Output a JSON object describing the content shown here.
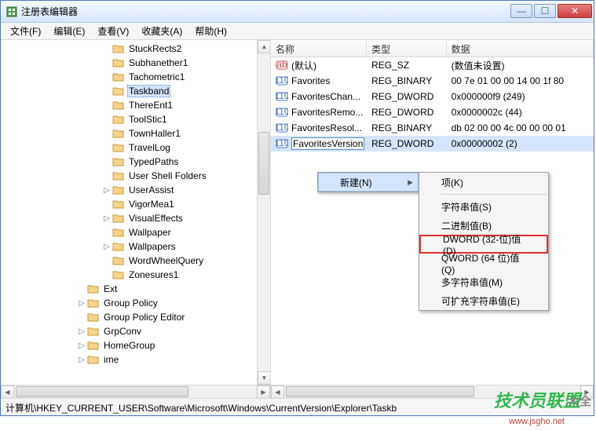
{
  "window": {
    "title": "注册表编辑器"
  },
  "menu": {
    "file": "文件(F)",
    "edit": "编辑(E)",
    "view": "查看(V)",
    "fav": "收藏夹(A)",
    "help": "帮助(H)"
  },
  "tree": {
    "items": [
      {
        "indent": 8,
        "expander": "",
        "label": "StuckRects2"
      },
      {
        "indent": 8,
        "expander": "",
        "label": "Subhanether1"
      },
      {
        "indent": 8,
        "expander": "",
        "label": "Tachometric1"
      },
      {
        "indent": 8,
        "expander": "",
        "label": "Taskband",
        "selected": true
      },
      {
        "indent": 8,
        "expander": "",
        "label": "ThereEnt1"
      },
      {
        "indent": 8,
        "expander": "",
        "label": "ToolStic1"
      },
      {
        "indent": 8,
        "expander": "",
        "label": "TownHaller1"
      },
      {
        "indent": 8,
        "expander": "",
        "label": "TravelLog"
      },
      {
        "indent": 8,
        "expander": "",
        "label": "TypedPaths"
      },
      {
        "indent": 8,
        "expander": "",
        "label": "User Shell Folders"
      },
      {
        "indent": 8,
        "expander": "▷",
        "label": "UserAssist"
      },
      {
        "indent": 8,
        "expander": "",
        "label": "VigorMea1"
      },
      {
        "indent": 8,
        "expander": "▷",
        "label": "VisualEffects"
      },
      {
        "indent": 8,
        "expander": "",
        "label": "Wallpaper"
      },
      {
        "indent": 8,
        "expander": "▷",
        "label": "Wallpapers"
      },
      {
        "indent": 8,
        "expander": "",
        "label": "WordWheelQuery"
      },
      {
        "indent": 8,
        "expander": "",
        "label": "Zonesures1"
      },
      {
        "indent": 6,
        "expander": "",
        "label": "Ext"
      },
      {
        "indent": 6,
        "expander": "▷",
        "label": "Group Policy"
      },
      {
        "indent": 6,
        "expander": "",
        "label": "Group Policy Editor"
      },
      {
        "indent": 6,
        "expander": "▷",
        "label": "GrpConv"
      },
      {
        "indent": 6,
        "expander": "▷",
        "label": "HomeGroup"
      },
      {
        "indent": 6,
        "expander": "▷",
        "label": "ime"
      }
    ]
  },
  "list": {
    "headers": {
      "name": "名称",
      "type": "类型",
      "data": "数据"
    },
    "rows": [
      {
        "icon": "str",
        "name": "(默认)",
        "type": "REG_SZ",
        "data": "(数值未设置)"
      },
      {
        "icon": "bin",
        "name": "Favorites",
        "type": "REG_BINARY",
        "data": "00 7e 01 00 00 14 00 1f 80"
      },
      {
        "icon": "bin",
        "name": "FavoritesChan...",
        "type": "REG_DWORD",
        "data": "0x000000f9 (249)"
      },
      {
        "icon": "bin",
        "name": "FavoritesRemo...",
        "type": "REG_DWORD",
        "data": "0x0000002c (44)"
      },
      {
        "icon": "bin",
        "name": "FavoritesResol...",
        "type": "REG_BINARY",
        "data": "db 02 00 00 4c 00 00 00 01"
      },
      {
        "icon": "bin",
        "name": "FavoritesVersion",
        "type": "REG_DWORD",
        "data": "0x00000002 (2)",
        "selected": true
      }
    ]
  },
  "context": {
    "new": "新建(N)",
    "sub": {
      "key": "项(K)",
      "string": "字符串值(S)",
      "binary": "二进制值(B)",
      "dword": "DWORD (32-位)值(D)",
      "qword": "QWORD (64 位)值(Q)",
      "multi": "多字符串值(M)",
      "expand": "可扩充字符串值(E)"
    }
  },
  "statusbar": "计算机\\HKEY_CURRENT_USER\\Software\\Microsoft\\Windows\\CurrentVersion\\Explorer\\Taskb",
  "watermark": {
    "brand": "技术员联盟",
    "url": "www.jsgho.net",
    "suffix": "大全"
  }
}
